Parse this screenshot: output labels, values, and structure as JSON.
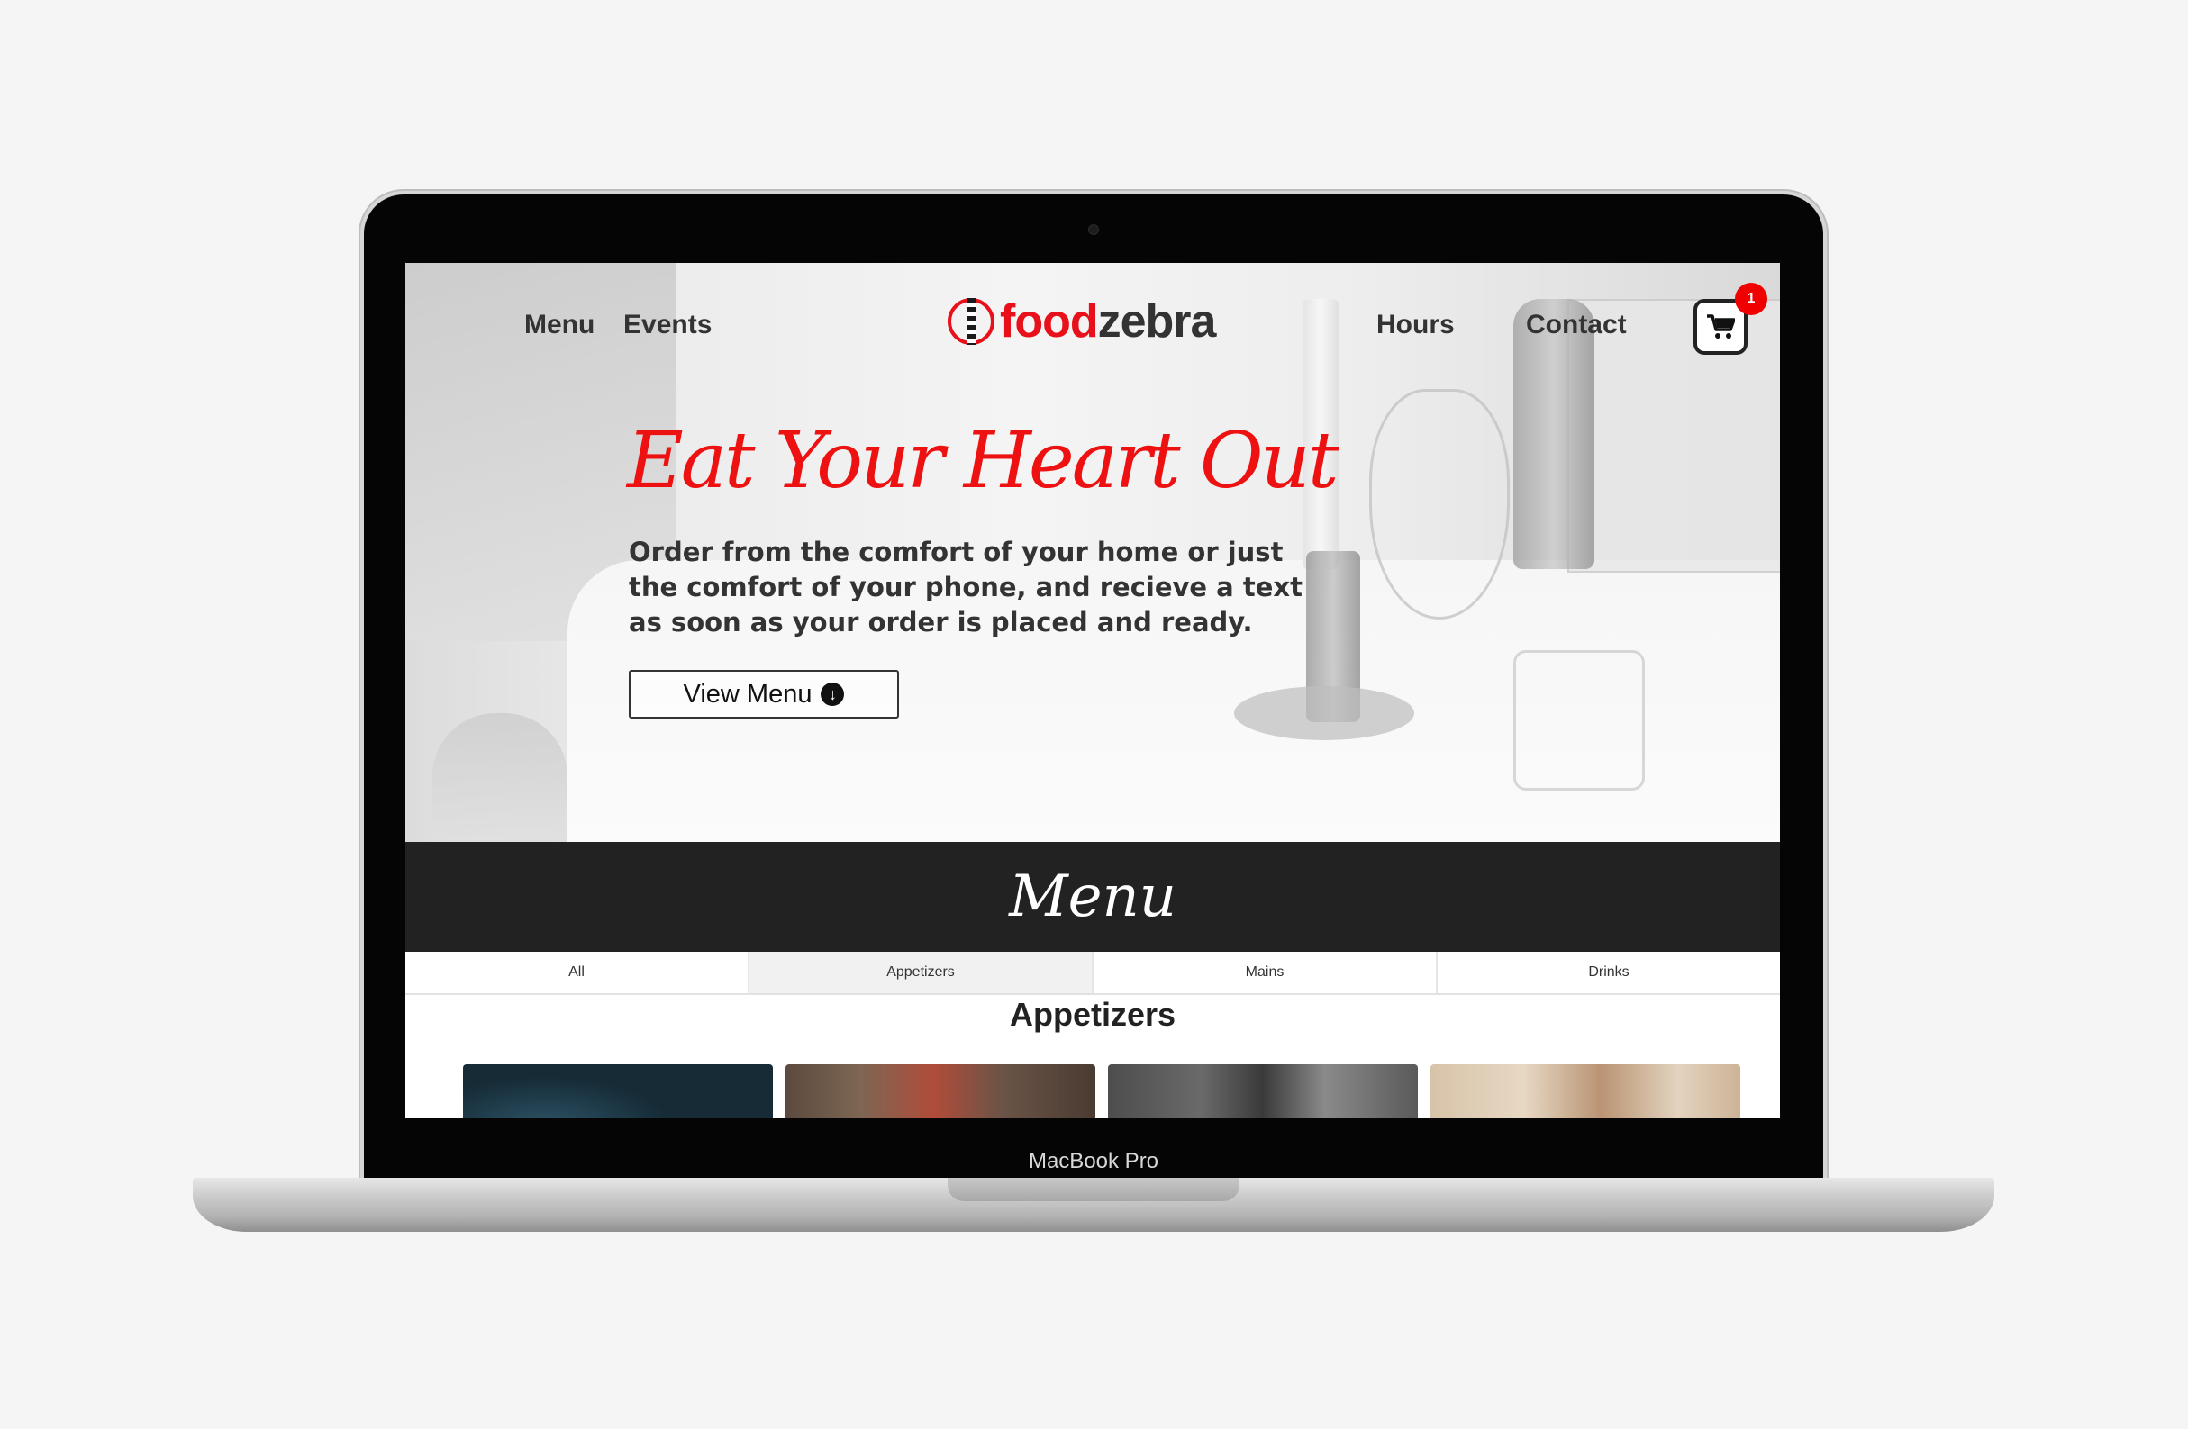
{
  "device": {
    "label": "MacBook Pro"
  },
  "nav": {
    "links_left": [
      "Menu",
      "Events"
    ],
    "links_right": [
      "Hours",
      "Contact"
    ],
    "logo": {
      "part1": "food",
      "part2": "zebra"
    },
    "cart": {
      "icon": "shopping-cart-icon",
      "badge_count": "1"
    }
  },
  "hero": {
    "title": "Eat Your Heart Out",
    "text": "Order from the comfort of your home or just the comfort of your phone, and recieve a text as soon as your order is placed and ready.",
    "button_label": "View Menu",
    "button_icon": "arrow-circle-down-icon"
  },
  "menu_section": {
    "title": "Menu",
    "tabs": [
      {
        "label": "All",
        "active": false
      },
      {
        "label": "Appetizers",
        "active": true
      },
      {
        "label": "Mains",
        "active": false
      },
      {
        "label": "Drinks",
        "active": false
      }
    ],
    "current_category": "Appetizers"
  },
  "colors": {
    "brand_red": "#e8101a",
    "dark_band": "#222222",
    "text_dark": "#333333"
  }
}
